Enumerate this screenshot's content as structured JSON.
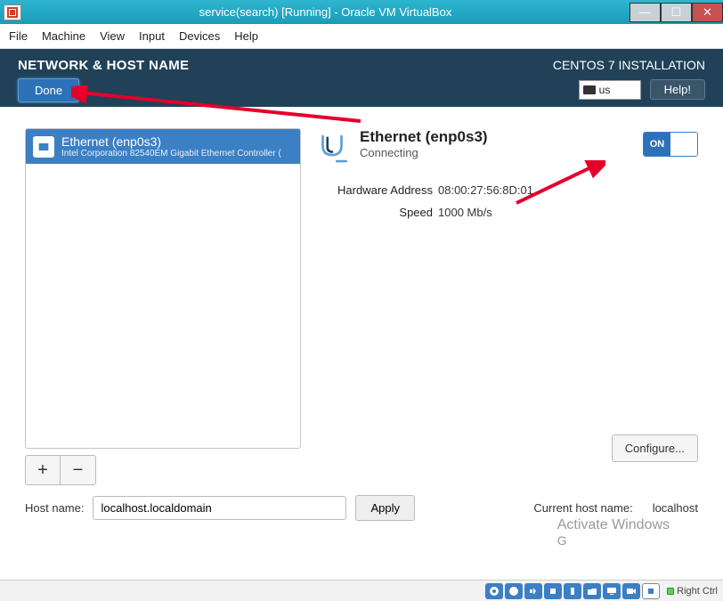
{
  "window": {
    "title": "service(search) [Running] - Oracle VM VirtualBox"
  },
  "menu": {
    "file": "File",
    "machine": "Machine",
    "view": "View",
    "input": "Input",
    "devices": "Devices",
    "help": "Help"
  },
  "header": {
    "title": "NETWORK & HOST NAME",
    "done_label": "Done",
    "install_title": "CENTOS 7 INSTALLATION",
    "keyboard_layout": "us",
    "help_label": "Help!"
  },
  "interfaces": [
    {
      "name": "Ethernet (enp0s3)",
      "subtitle": "Intel Corporation 82540EM Gigabit Ethernet Controller ("
    }
  ],
  "buttons": {
    "add": "+",
    "remove": "−",
    "configure": "Configure...",
    "apply": "Apply"
  },
  "detail": {
    "title": "Ethernet (enp0s3)",
    "status": "Connecting",
    "toggle_label": "ON",
    "hw_addr_label": "Hardware Address",
    "hw_addr_value": "08:00:27:56:8D:01",
    "speed_label": "Speed",
    "speed_value": "1000 Mb/s"
  },
  "hostname": {
    "label": "Host name:",
    "value": "localhost.localdomain",
    "current_label": "Current host name:",
    "current_value": "localhost"
  },
  "activate": {
    "line1": "Activate Windows",
    "line2": "G"
  },
  "taskbar": {
    "rightctrl": "Right Ctrl"
  }
}
